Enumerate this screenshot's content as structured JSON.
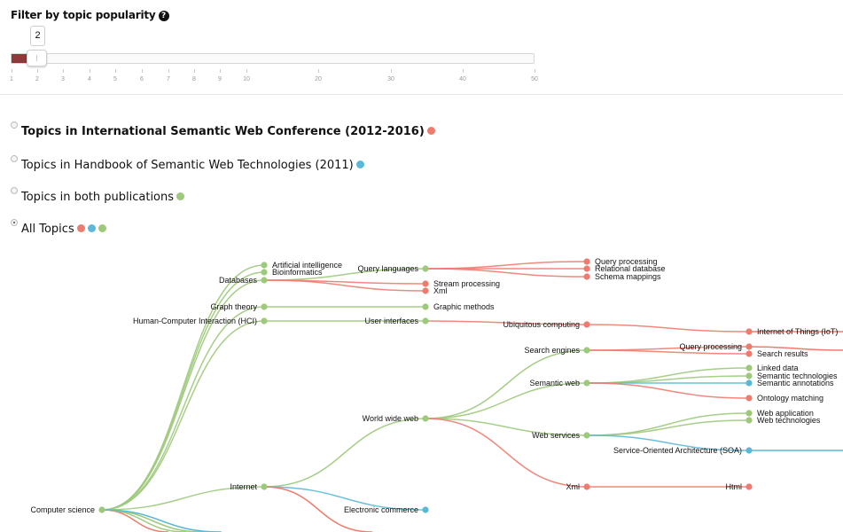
{
  "filter": {
    "title": "Filter by topic popularity",
    "help_icon": "question-circle-icon",
    "value": "2",
    "ticks": [
      "1",
      "2",
      "3",
      "4",
      "5",
      "6",
      "7",
      "8",
      "9",
      "10",
      "20",
      "30",
      "40",
      "50"
    ]
  },
  "options": [
    {
      "label": "Topics in International Semantic Web Conference (2012-2016)",
      "dots": [
        "#ef7b6e"
      ],
      "bold": true,
      "checked": false
    },
    {
      "label": "Topics in Handbook of Semantic Web Technologies (2011)",
      "dots": [
        "#5bb8d9"
      ],
      "bold": false,
      "checked": false
    },
    {
      "label": "Topics in both publications",
      "dots": [
        "#9dc97b"
      ],
      "bold": false,
      "checked": false
    },
    {
      "label": "All Topics",
      "dots": [
        "#ef7b6e",
        "#5bb8d9",
        "#9dc97b"
      ],
      "bold": false,
      "checked": true
    }
  ],
  "colors": {
    "isw": "#ef7b6e",
    "handbook": "#5bb8d9",
    "both": "#9dc97b",
    "slider_fill": "#8e3a3a"
  },
  "tree": {
    "nodes": [
      {
        "label": "Computer science",
        "color": "both"
      },
      {
        "label": "Artificial intelligence",
        "color": "both"
      },
      {
        "label": "Bioinformatics",
        "color": "both"
      },
      {
        "label": "Databases",
        "color": "both"
      },
      {
        "label": "Graph theory",
        "color": "both"
      },
      {
        "label": "Human-Computer Interaction (HCI)",
        "color": "both"
      },
      {
        "label": "Internet",
        "color": "both"
      },
      {
        "label": "Query languages",
        "color": "both"
      },
      {
        "label": "Stream processing",
        "color": "isw"
      },
      {
        "label": "Xml",
        "color": "isw"
      },
      {
        "label": "Graphic methods",
        "color": "both"
      },
      {
        "label": "User interfaces",
        "color": "both"
      },
      {
        "label": "World wide web",
        "color": "both"
      },
      {
        "label": "Electronic commerce",
        "color": "handbook"
      },
      {
        "label": "Query processing",
        "color": "isw"
      },
      {
        "label": "Relational database",
        "color": "isw"
      },
      {
        "label": "Schema mappings",
        "color": "isw"
      },
      {
        "label": "Ubiquitous computing",
        "color": "isw"
      },
      {
        "label": "Search engines",
        "color": "both"
      },
      {
        "label": "Semantic web",
        "color": "both"
      },
      {
        "label": "Web services",
        "color": "both"
      },
      {
        "label": "Xml",
        "color": "isw"
      },
      {
        "label": "Internet of Things (IoT)",
        "color": "isw"
      },
      {
        "label": "Query processing",
        "color": "isw"
      },
      {
        "label": "Search results",
        "color": "isw"
      },
      {
        "label": "Linked data",
        "color": "both"
      },
      {
        "label": "Semantic technologies",
        "color": "both"
      },
      {
        "label": "Semantic annotations",
        "color": "handbook"
      },
      {
        "label": "Ontology matching",
        "color": "isw"
      },
      {
        "label": "Web application",
        "color": "both"
      },
      {
        "label": "Web technologies",
        "color": "both"
      },
      {
        "label": "Service-Oriented Architecture (SOA)",
        "color": "handbook"
      },
      {
        "label": "Html",
        "color": "isw"
      }
    ],
    "links": [
      [
        0,
        1,
        "both"
      ],
      [
        0,
        2,
        "both"
      ],
      [
        0,
        3,
        "both"
      ],
      [
        0,
        4,
        "both"
      ],
      [
        0,
        5,
        "both"
      ],
      [
        0,
        6,
        "both"
      ],
      [
        3,
        7,
        "both"
      ],
      [
        3,
        8,
        "isw"
      ],
      [
        3,
        9,
        "isw"
      ],
      [
        4,
        10,
        "both"
      ],
      [
        5,
        11,
        "both"
      ],
      [
        6,
        12,
        "both"
      ],
      [
        6,
        13,
        "handbook"
      ],
      [
        7,
        14,
        "isw"
      ],
      [
        7,
        15,
        "isw"
      ],
      [
        7,
        16,
        "isw"
      ],
      [
        11,
        17,
        "isw"
      ],
      [
        12,
        18,
        "both"
      ],
      [
        12,
        19,
        "both"
      ],
      [
        12,
        20,
        "both"
      ],
      [
        12,
        21,
        "isw"
      ],
      [
        17,
        22,
        "isw"
      ],
      [
        18,
        23,
        "isw"
      ],
      [
        18,
        24,
        "isw"
      ],
      [
        19,
        25,
        "both"
      ],
      [
        19,
        26,
        "both"
      ],
      [
        19,
        27,
        "handbook"
      ],
      [
        19,
        28,
        "isw"
      ],
      [
        20,
        29,
        "both"
      ],
      [
        20,
        30,
        "both"
      ],
      [
        20,
        31,
        "handbook"
      ],
      [
        21,
        32,
        "isw"
      ]
    ]
  }
}
